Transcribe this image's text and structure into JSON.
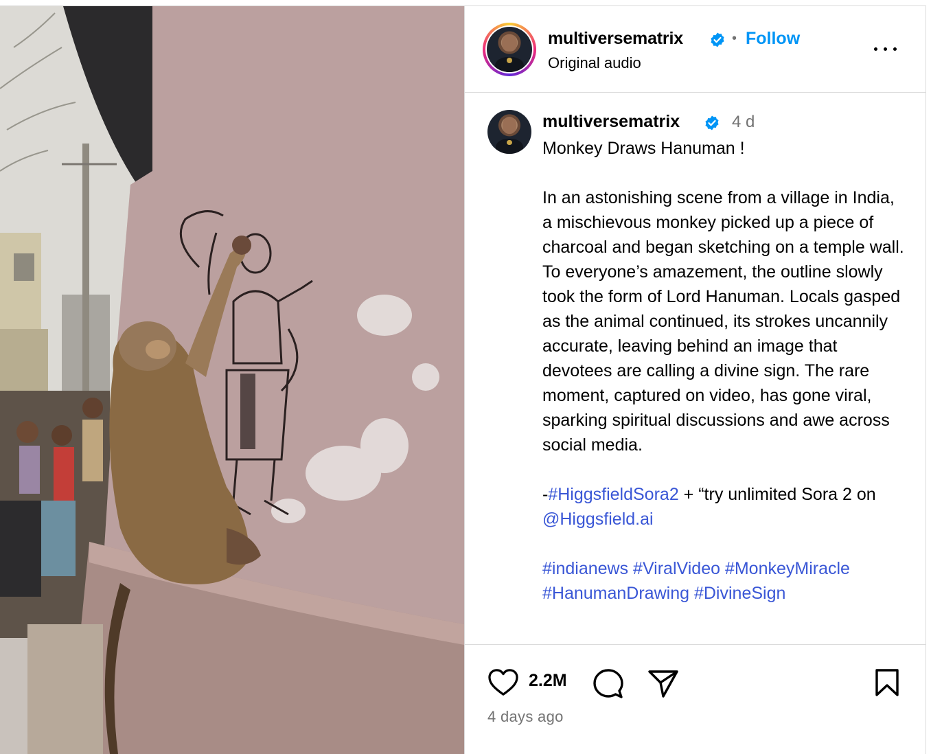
{
  "post": {
    "username": "multiversematrix",
    "follow_label": "Follow",
    "audio_label": "Original audio",
    "header_separator": "•",
    "more_icon": "more-horizontal-icon",
    "verified_icon": "verified-badge-icon"
  },
  "caption": {
    "username": "multiversematrix",
    "time": "4 d",
    "title": "Monkey Draws Hanuman !",
    "body": "In an astonishing scene from a village in India, a mischievous monkey picked up a piece of charcoal and began sketching on a temple wall. To everyone’s amazement, the outline slowly took the form of Lord Hanuman. Locals gasped as the animal continued, its strokes uncannily accurate, leaving behind an image that devotees are calling a divine sign. The rare moment, captured on video, has gone viral, sparking spiritual discussions and awe across social media.",
    "promo_prefix": "-",
    "promo_hashtag": "#HiggsfieldSora2",
    "promo_text": " + “try unlimited Sora 2 on ",
    "promo_mention": "@Higgsfield.ai",
    "hashtags": [
      "#indianews",
      "#ViralVideo",
      "#MonkeyMiracle",
      "#HanumanDrawing",
      "#DivineSign"
    ]
  },
  "actions": {
    "like_icon": "heart-icon",
    "comment_icon": "comment-icon",
    "share_icon": "send-icon",
    "save_icon": "bookmark-icon",
    "likes_count": "2.2M",
    "posted_ago": "4 days ago"
  },
  "colors": {
    "accent": "#0095f6",
    "link": "#3a57d6",
    "muted": "#737373",
    "border": "#dbdbdb"
  }
}
